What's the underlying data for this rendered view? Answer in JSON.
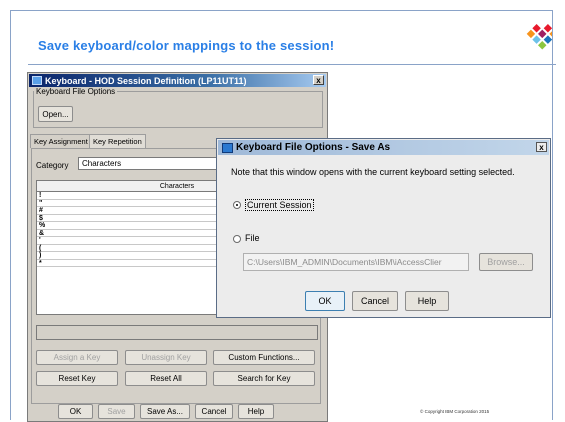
{
  "slide": {
    "title": "Save keyboard/color mappings to the session!",
    "copyright": "© Copyright IBM Corporation 2015"
  },
  "main_window": {
    "title": "Keyboard - HOD Session Definition (LP11UT11)",
    "close": "x",
    "file_options_group": "Keyboard File Options",
    "open_button": "Open...",
    "tabs": [
      "Key Assignment",
      "Key Repetition"
    ],
    "category_label": "Category",
    "category_value": "Characters",
    "table_header": "Characters",
    "rows": [
      "!",
      "\"",
      "#",
      "$",
      "%",
      "&",
      "'",
      "(",
      ")",
      "*"
    ],
    "buttons_row1": [
      "Assign a Key",
      "Unassign Key",
      "Custom Functions..."
    ],
    "buttons_row2": [
      "Reset Key",
      "Reset All",
      "Search for Key"
    ],
    "bottom_buttons": [
      "OK",
      "Save",
      "Save As...",
      "Cancel",
      "Help"
    ]
  },
  "dialog": {
    "title": "Keyboard File Options - Save As",
    "close": "x",
    "note": "Note that this window opens with the current keyboard setting selected.",
    "option_current": "Current Session",
    "option_file": "File",
    "file_path": "C:\\Users\\IBM_ADMIN\\Documents\\IBM\\iAccessClier",
    "browse": "Browse...",
    "ok": "OK",
    "cancel": "Cancel",
    "help": "Help",
    "selected_option": "current"
  },
  "colors": {
    "title_blue": "#2a7fe6",
    "logo": [
      "#e8192c",
      "#f7941d",
      "#1b75bc",
      "#6dc2e9",
      "#8dc63f",
      "#9e1f63"
    ]
  }
}
